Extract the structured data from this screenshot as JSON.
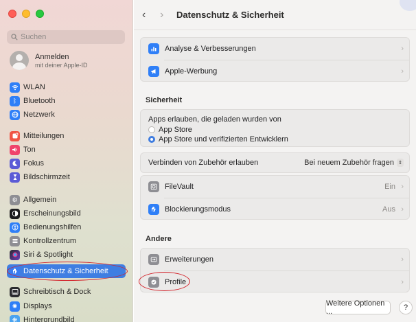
{
  "window": {
    "title": "Datenschutz & Sicherheit"
  },
  "search": {
    "placeholder": "Suchen"
  },
  "account": {
    "line1": "Anmelden",
    "line2": "mit deiner Apple-ID"
  },
  "sidebar": {
    "items": [
      {
        "label": "WLAN",
        "icon": "wifi-icon",
        "color": "#2f7ff7"
      },
      {
        "label": "Bluetooth",
        "icon": "bluetooth-icon",
        "color": "#2f7ff7"
      },
      {
        "label": "Netzwerk",
        "icon": "globe-icon",
        "color": "#2f7ff7"
      },
      {
        "label": "Mitteilungen",
        "icon": "bell-icon",
        "color": "#f05545"
      },
      {
        "label": "Ton",
        "icon": "speaker-icon",
        "color": "#f0436b"
      },
      {
        "label": "Fokus",
        "icon": "moon-icon",
        "color": "#5b5bd6"
      },
      {
        "label": "Bildschirmzeit",
        "icon": "hourglass-icon",
        "color": "#5b5bd6"
      },
      {
        "label": "Allgemein",
        "icon": "gear-icon",
        "color": "#8e8e93"
      },
      {
        "label": "Erscheinungsbild",
        "icon": "appearance-icon",
        "color": "#1c1c1e"
      },
      {
        "label": "Bedienungshilfen",
        "icon": "accessibility-icon",
        "color": "#2f7ff7"
      },
      {
        "label": "Kontrollzentrum",
        "icon": "control-center-icon",
        "color": "#8e8e93"
      },
      {
        "label": "Siri & Spotlight",
        "icon": "siri-icon",
        "color": "#2a2a2e"
      },
      {
        "label": "Datenschutz & Sicherheit",
        "icon": "hand-icon",
        "color": "#3a7bf0",
        "selected": true
      },
      {
        "label": "Schreibtisch & Dock",
        "icon": "dock-icon",
        "color": "#2a2a2e"
      },
      {
        "label": "Displays",
        "icon": "sun-icon",
        "color": "#2f7ff7"
      },
      {
        "label": "Hintergrundbild",
        "icon": "wallpaper-icon",
        "color": "#4aa3f0"
      }
    ]
  },
  "main": {
    "top_rows": [
      {
        "label": "Analyse & Verbesserungen",
        "icon": "chart-icon",
        "color": "#2f7ff7"
      },
      {
        "label": "Apple-Werbung",
        "icon": "megaphone-icon",
        "color": "#2f7ff7"
      }
    ],
    "security": {
      "heading": "Sicherheit",
      "apps_label": "Apps erlauben, die geladen wurden von",
      "options": [
        "App Store",
        "App Store und verifizierten Entwicklern"
      ],
      "selected_option": 1,
      "accessory_label": "Verbinden von Zubehör erlauben",
      "accessory_value": "Bei neuem Zubehör fragen",
      "filevault_label": "FileVault",
      "filevault_value": "Ein",
      "lockdown_label": "Blockierungsmodus",
      "lockdown_value": "Aus"
    },
    "other": {
      "heading": "Andere",
      "extensions_label": "Erweiterungen",
      "profiles_label": "Profile"
    },
    "more_button": "Weitere Optionen ...",
    "help_button": "?"
  },
  "annotations": {
    "highlight_color": "#d2222a"
  }
}
